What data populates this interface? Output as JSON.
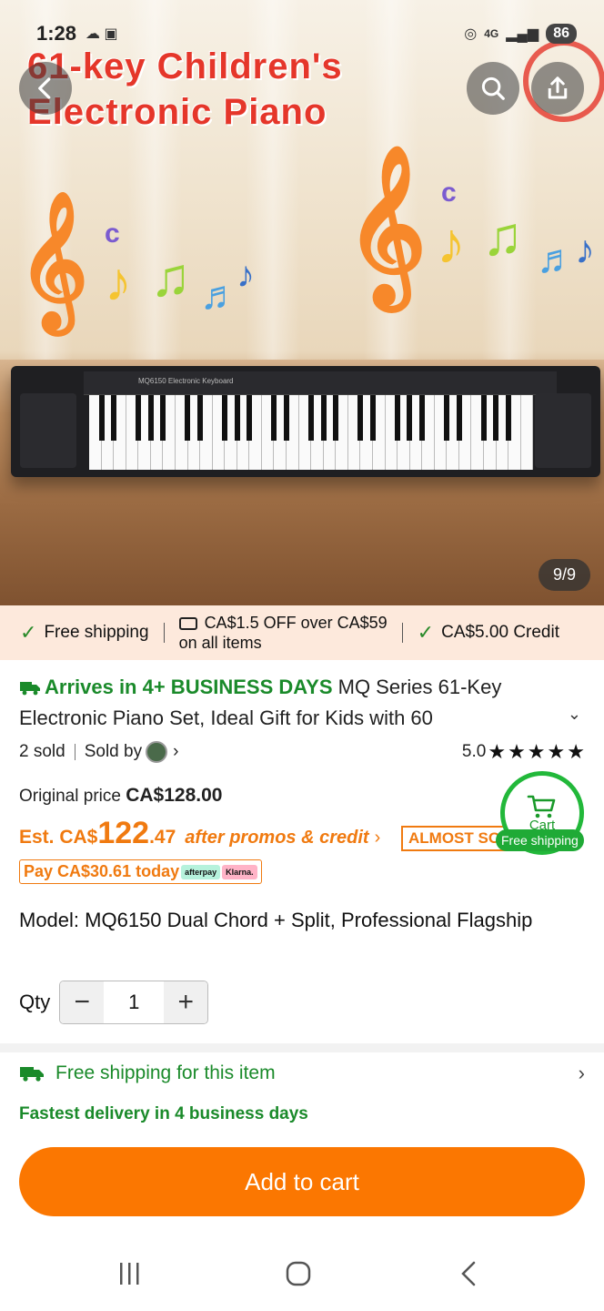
{
  "status_bar": {
    "time": "1:28",
    "network": "4G",
    "battery": "86"
  },
  "hero": {
    "title_line1": "61-key Children's",
    "title_line2": "Electronic Piano",
    "image_counter": "9/9",
    "keyboard_panel_text": "MQ6150 Electronic Keyboard"
  },
  "promo_strip": {
    "item1": "Free shipping",
    "item2_line1": "CA$1.5 OFF over CA$59",
    "item2_line2": "on all items",
    "item3": "CA$5.00 Credit"
  },
  "product": {
    "arrives": "Arrives in 4+ BUSINESS DAYS",
    "title_part1": " MQ Series 61-Key",
    "title_part2": "Electronic Piano Set, Ideal Gift for Kids with 60",
    "sold": "2 sold",
    "sold_by": "Sold by",
    "rating": "5.0",
    "original_price_label": "Original price",
    "original_price": "CA$128.00",
    "est_label": "Est. CA$",
    "est_whole": "122",
    "est_cents": ".47",
    "promo_text": "after promos & credit",
    "almost_badge": "ALMOST SOLD OUT",
    "pay_today": "Pay CA$30.61 today",
    "afterpay": "afterpay",
    "klarna": "Klarna.",
    "model": "Model: MQ6150 Dual Chord + Split, Professional Flagship",
    "qty_label": "Qty",
    "qty_value": "1"
  },
  "cart_bubble": {
    "label": "Cart",
    "tag": "Free shipping"
  },
  "shipping": {
    "title": "Free shipping for this item",
    "fastest": "Fastest delivery in 4 business days"
  },
  "add_to_cart": "Add to cart",
  "colors": {
    "accent_orange": "#fb7701",
    "green": "#1a8a2a",
    "title_red": "#e5362a"
  }
}
